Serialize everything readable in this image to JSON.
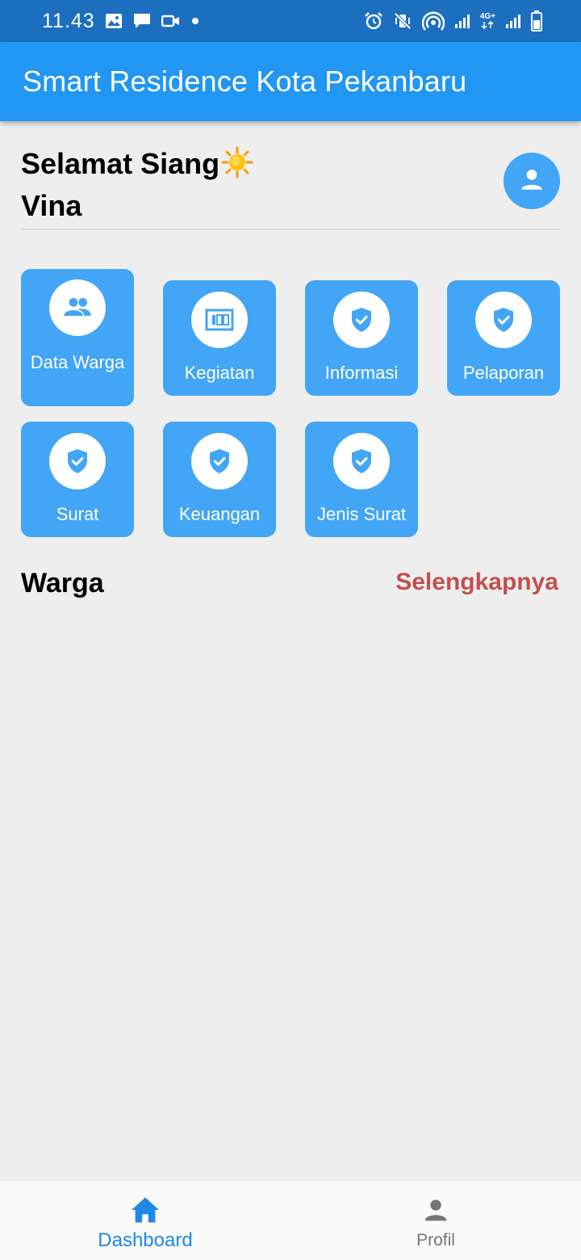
{
  "status_bar": {
    "time": "11.43",
    "left_icons": [
      "image-icon",
      "chat-icon",
      "video-icon",
      "dot-icon"
    ],
    "right_icons": [
      "alarm-icon",
      "vibrate-off-icon",
      "hotspot-icon",
      "signal-icon",
      "network-4g-icon",
      "signal-icon",
      "battery-icon"
    ],
    "network_label": "4G+"
  },
  "app_bar": {
    "title": "Smart Residence Kota Pekanbaru"
  },
  "greeting": {
    "salutation": "Selamat Siang",
    "emoji_icon": "sun-icon",
    "name": "Vina"
  },
  "menu": [
    {
      "label": "Data Warga",
      "icon": "people-icon"
    },
    {
      "label": "Kegiatan",
      "icon": "counter-icon"
    },
    {
      "label": "Informasi",
      "icon": "shield-check-icon"
    },
    {
      "label": "Pelaporan",
      "icon": "shield-check-icon"
    },
    {
      "label": "Surat",
      "icon": "shield-check-icon"
    },
    {
      "label": "Keuangan",
      "icon": "shield-check-icon"
    },
    {
      "label": "Jenis Surat",
      "icon": "shield-check-icon"
    }
  ],
  "section": {
    "title": "Warga",
    "see_more": "Selengkapnya"
  },
  "bottom_nav": [
    {
      "label": "Dashboard",
      "icon": "home-icon",
      "active": true
    },
    {
      "label": "Profil",
      "icon": "person-icon",
      "active": false
    }
  ],
  "colors": {
    "status_bar": "#1c6fbf",
    "app_bar": "#2196f3",
    "tile": "#42a5f5",
    "link": "#c0504d",
    "nav_active": "#1e88e5",
    "nav_inactive": "#757575"
  }
}
